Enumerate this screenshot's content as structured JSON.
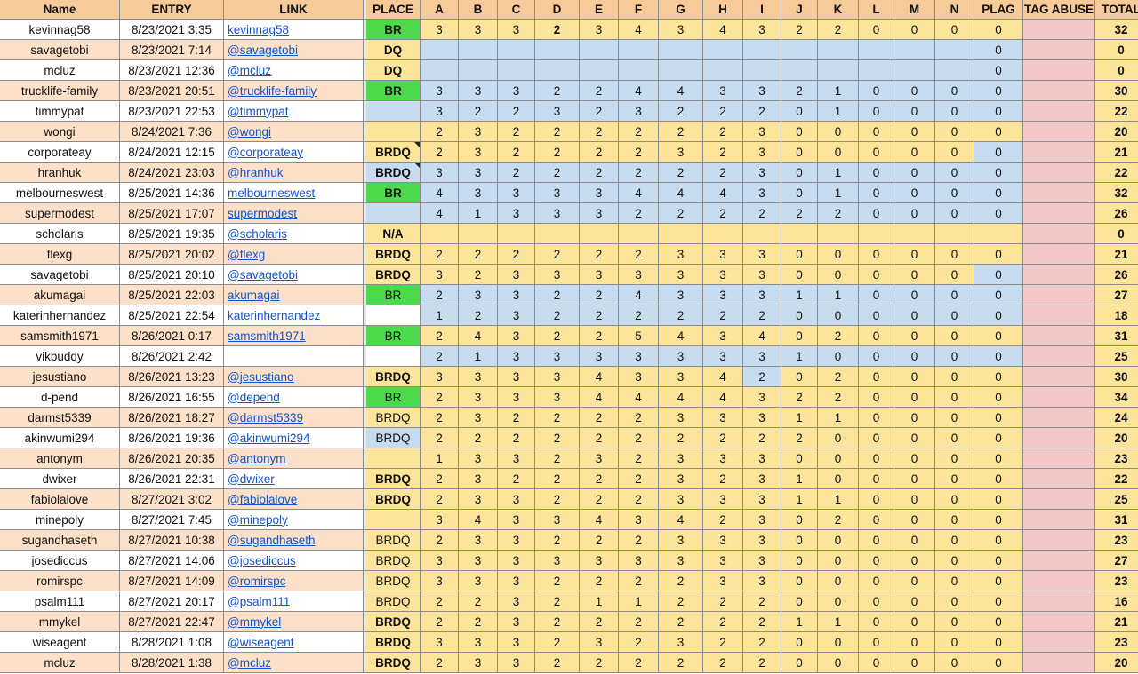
{
  "columns": {
    "name": "Name",
    "entry": "ENTRY",
    "link": "LINK",
    "place": "PLACE",
    "scores": [
      "A",
      "B",
      "C",
      "D",
      "E",
      "F",
      "G",
      "H",
      "I",
      "J",
      "K",
      "L",
      "M",
      "N"
    ],
    "plag": "PLAG",
    "tag_abuse": "TAG ABUSE",
    "total": "TOTAL"
  },
  "colors": {
    "header": "#f7cb99",
    "alt_row": "#fce1c8",
    "score_yellow": "#fde49b",
    "score_blue": "#c8dcf0",
    "place_green": "#4cda4c",
    "tag_abuse_pink": "#f3c8c8",
    "link_blue": "#1155cc"
  },
  "rows": [
    {
      "name": "kevinnag58",
      "entry": "8/23/2021 3:35",
      "link": "kevinnag58",
      "place": "BR",
      "scores": [
        "3",
        "3",
        "3",
        "2",
        "3",
        "4",
        "3",
        "4",
        "3",
        "2",
        "2",
        "0",
        "0",
        "0"
      ],
      "plag": "0",
      "total": "32"
    },
    {
      "name": "savagetobi",
      "entry": "8/23/2021 7:14",
      "link": "@savagetobi",
      "place": "DQ",
      "scores": [
        "",
        "",
        "",
        "",
        "",
        "",
        "",
        "",
        "",
        "",
        "",
        "",
        "",
        ""
      ],
      "plag": "0",
      "total": "0"
    },
    {
      "name": "mcluz",
      "entry": "8/23/2021 12:36",
      "link": "@mcluz",
      "place": "DQ",
      "scores": [
        "",
        "",
        "",
        "",
        "",
        "",
        "",
        "",
        "",
        "",
        "",
        "",
        "",
        ""
      ],
      "plag": "0",
      "total": "0"
    },
    {
      "name": "trucklife-family",
      "entry": "8/23/2021 20:51",
      "link": "@trucklife-family",
      "place": "BR",
      "scores": [
        "3",
        "3",
        "3",
        "2",
        "2",
        "4",
        "4",
        "3",
        "3",
        "2",
        "1",
        "0",
        "0",
        "0"
      ],
      "plag": "0",
      "total": "30"
    },
    {
      "name": "timmypat",
      "entry": "8/23/2021 22:53",
      "link": "@timmypat",
      "place": "",
      "scores": [
        "3",
        "2",
        "2",
        "3",
        "2",
        "3",
        "2",
        "2",
        "2",
        "0",
        "1",
        "0",
        "0",
        "0"
      ],
      "plag": "0",
      "total": "22"
    },
    {
      "name": "wongi",
      "entry": "8/24/2021 7:36",
      "link": "@wongi",
      "place": "",
      "scores": [
        "2",
        "3",
        "2",
        "2",
        "2",
        "2",
        "2",
        "2",
        "3",
        "0",
        "0",
        "0",
        "0",
        "0"
      ],
      "plag": "0",
      "total": "20"
    },
    {
      "name": "corporateay",
      "entry": "8/24/2021 12:15",
      "link": "@corporateay",
      "place": "BRDQ",
      "scores": [
        "2",
        "3",
        "2",
        "2",
        "2",
        "2",
        "3",
        "2",
        "3",
        "0",
        "0",
        "0",
        "0",
        "0"
      ],
      "plag": "0",
      "total": "21"
    },
    {
      "name": "hranhuk",
      "entry": "8/24/2021 23:03",
      "link": "@hranhuk",
      "place": "BRDQ",
      "scores": [
        "3",
        "3",
        "2",
        "2",
        "2",
        "2",
        "2",
        "2",
        "3",
        "0",
        "1",
        "0",
        "0",
        "0"
      ],
      "plag": "0",
      "total": "22"
    },
    {
      "name": "melbourneswest",
      "entry": "8/25/2021 14:36",
      "link": "melbourneswest",
      "place": "BR",
      "scores": [
        "4",
        "3",
        "3",
        "3",
        "3",
        "4",
        "4",
        "4",
        "3",
        "0",
        "1",
        "0",
        "0",
        "0"
      ],
      "plag": "0",
      "total": "32"
    },
    {
      "name": "supermodest",
      "entry": "8/25/2021 17:07",
      "link": "supermodest",
      "place": "",
      "scores": [
        "4",
        "1",
        "3",
        "3",
        "3",
        "2",
        "2",
        "2",
        "2",
        "2",
        "2",
        "0",
        "0",
        "0"
      ],
      "plag": "0",
      "total": "26"
    },
    {
      "name": "scholaris",
      "entry": "8/25/2021 19:35",
      "link": "@scholaris",
      "place": "N/A",
      "scores": [
        "",
        "",
        "",
        "",
        "",
        "",
        "",
        "",
        "",
        "",
        "",
        "",
        "",
        ""
      ],
      "plag": "",
      "total": "0"
    },
    {
      "name": "flexg",
      "entry": "8/25/2021 20:02",
      "link": "@flexg",
      "place": "BRDQ",
      "scores": [
        "2",
        "2",
        "2",
        "2",
        "2",
        "2",
        "3",
        "3",
        "3",
        "0",
        "0",
        "0",
        "0",
        "0"
      ],
      "plag": "0",
      "total": "21"
    },
    {
      "name": "savagetobi",
      "entry": "8/25/2021 20:10",
      "link": "@savagetobi",
      "place": "BRDQ",
      "scores": [
        "3",
        "2",
        "3",
        "3",
        "3",
        "3",
        "3",
        "3",
        "3",
        "0",
        "0",
        "0",
        "0",
        "0"
      ],
      "plag": "0",
      "total": "26"
    },
    {
      "name": "akumagai",
      "entry": "8/25/2021 22:03",
      "link": "akumagai",
      "place": "BR",
      "scores": [
        "2",
        "3",
        "3",
        "2",
        "2",
        "4",
        "3",
        "3",
        "3",
        "1",
        "1",
        "0",
        "0",
        "0"
      ],
      "plag": "0",
      "total": "27"
    },
    {
      "name": "katerinhernandez",
      "entry": "8/25/2021 22:54",
      "link": "katerinhernandez",
      "place": "",
      "scores": [
        "1",
        "2",
        "3",
        "2",
        "2",
        "2",
        "2",
        "2",
        "2",
        "0",
        "0",
        "0",
        "0",
        "0"
      ],
      "plag": "0",
      "total": "18"
    },
    {
      "name": "samsmith1971",
      "entry": "8/26/2021 0:17",
      "link": "samsmith1971",
      "place": "BR",
      "scores": [
        "2",
        "4",
        "3",
        "2",
        "2",
        "5",
        "4",
        "3",
        "4",
        "0",
        "2",
        "0",
        "0",
        "0"
      ],
      "plag": "0",
      "total": "31"
    },
    {
      "name": "vikbuddy",
      "entry": "8/26/2021 2:42",
      "link": "",
      "place": "",
      "scores": [
        "2",
        "1",
        "3",
        "3",
        "3",
        "3",
        "3",
        "3",
        "3",
        "1",
        "0",
        "0",
        "0",
        "0"
      ],
      "plag": "0",
      "total": "25"
    },
    {
      "name": "jesustiano",
      "entry": "8/26/2021 13:23",
      "link": "@jesustiano",
      "place": "BRDQ",
      "scores": [
        "3",
        "3",
        "3",
        "3",
        "4",
        "3",
        "3",
        "4",
        "2",
        "0",
        "2",
        "0",
        "0",
        "0"
      ],
      "plag": "0",
      "total": "30"
    },
    {
      "name": "d-pend",
      "entry": "8/26/2021 16:55",
      "link": "@depend",
      "place": "BR",
      "scores": [
        "2",
        "3",
        "3",
        "3",
        "4",
        "4",
        "4",
        "4",
        "3",
        "2",
        "2",
        "0",
        "0",
        "0"
      ],
      "plag": "0",
      "total": "34"
    },
    {
      "name": "darmst5339",
      "entry": "8/26/2021 18:27",
      "link": "@darmst5339",
      "place": "BRDQ",
      "scores": [
        "2",
        "3",
        "2",
        "2",
        "2",
        "2",
        "3",
        "3",
        "3",
        "1",
        "1",
        "0",
        "0",
        "0"
      ],
      "plag": "0",
      "total": "24"
    },
    {
      "name": "akinwumi294",
      "entry": "8/26/2021 19:36",
      "link": "@akinwumi294",
      "place": "BRDQ",
      "scores": [
        "2",
        "2",
        "2",
        "2",
        "2",
        "2",
        "2",
        "2",
        "2",
        "2",
        "0",
        "0",
        "0",
        "0"
      ],
      "plag": "0",
      "total": "20"
    },
    {
      "name": "antonym",
      "entry": "8/26/2021 20:35",
      "link": "@antonym",
      "place": "",
      "scores": [
        "1",
        "3",
        "3",
        "2",
        "3",
        "2",
        "3",
        "3",
        "3",
        "0",
        "0",
        "0",
        "0",
        "0"
      ],
      "plag": "0",
      "total": "23"
    },
    {
      "name": "dwixer",
      "entry": "8/26/2021 22:31",
      "link": "@dwixer",
      "place": "BRDQ",
      "scores": [
        "2",
        "3",
        "2",
        "2",
        "2",
        "2",
        "3",
        "2",
        "3",
        "1",
        "0",
        "0",
        "0",
        "0"
      ],
      "plag": "0",
      "total": "22"
    },
    {
      "name": "fabiolalove",
      "entry": "8/27/2021 3:02",
      "link": "@fabiolalove",
      "place": "BRDQ",
      "scores": [
        "2",
        "3",
        "3",
        "2",
        "2",
        "2",
        "3",
        "3",
        "3",
        "1",
        "1",
        "0",
        "0",
        "0"
      ],
      "plag": "0",
      "total": "25"
    },
    {
      "name": "minepoly",
      "entry": "8/27/2021 7:45",
      "link": "@minepoly",
      "place": "",
      "scores": [
        "3",
        "4",
        "3",
        "3",
        "4",
        "3",
        "4",
        "2",
        "3",
        "0",
        "2",
        "0",
        "0",
        "0"
      ],
      "plag": "0",
      "total": "31"
    },
    {
      "name": "sugandhaseth",
      "entry": "8/27/2021 10:38",
      "link": "@sugandhaseth",
      "place": "BRDQ",
      "scores": [
        "2",
        "3",
        "3",
        "2",
        "2",
        "2",
        "3",
        "3",
        "3",
        "0",
        "0",
        "0",
        "0",
        "0"
      ],
      "plag": "0",
      "total": "23"
    },
    {
      "name": "josediccus",
      "entry": "8/27/2021 14:06",
      "link": "@josediccus",
      "place": "BRDQ",
      "scores": [
        "3",
        "3",
        "3",
        "3",
        "3",
        "3",
        "3",
        "3",
        "3",
        "0",
        "0",
        "0",
        "0",
        "0"
      ],
      "plag": "0",
      "total": "27"
    },
    {
      "name": "romirspc",
      "entry": "8/27/2021 14:09",
      "link": "@romirspc",
      "place": "BRDQ",
      "scores": [
        "3",
        "3",
        "3",
        "2",
        "2",
        "2",
        "2",
        "3",
        "3",
        "0",
        "0",
        "0",
        "0",
        "0"
      ],
      "plag": "0",
      "total": "23"
    },
    {
      "name": "psalm111",
      "entry": "8/27/2021 20:17",
      "link": "@psalm111",
      "place": "BRDQ",
      "scores": [
        "2",
        "2",
        "3",
        "2",
        "1",
        "1",
        "2",
        "2",
        "2",
        "0",
        "0",
        "0",
        "0",
        "0"
      ],
      "plag": "0",
      "total": "16"
    },
    {
      "name": "mmykel",
      "entry": "8/27/2021 22:47",
      "link": "@mmykel",
      "place": "BRDQ",
      "scores": [
        "2",
        "2",
        "3",
        "2",
        "2",
        "2",
        "2",
        "2",
        "2",
        "1",
        "1",
        "0",
        "0",
        "0"
      ],
      "plag": "0",
      "total": "21"
    },
    {
      "name": "wiseagent",
      "entry": "8/28/2021 1:08",
      "link": "@wiseagent",
      "place": "BRDQ",
      "scores": [
        "3",
        "3",
        "3",
        "2",
        "3",
        "2",
        "3",
        "2",
        "2",
        "0",
        "0",
        "0",
        "0",
        "0"
      ],
      "plag": "0",
      "total": "23"
    },
    {
      "name": "mcluz",
      "entry": "8/28/2021 1:38",
      "link": "@mcluz",
      "place": "BRDQ",
      "scores": [
        "2",
        "3",
        "3",
        "2",
        "2",
        "2",
        "2",
        "2",
        "2",
        "0",
        "0",
        "0",
        "0",
        "0"
      ],
      "plag": "0",
      "total": "20"
    }
  ]
}
